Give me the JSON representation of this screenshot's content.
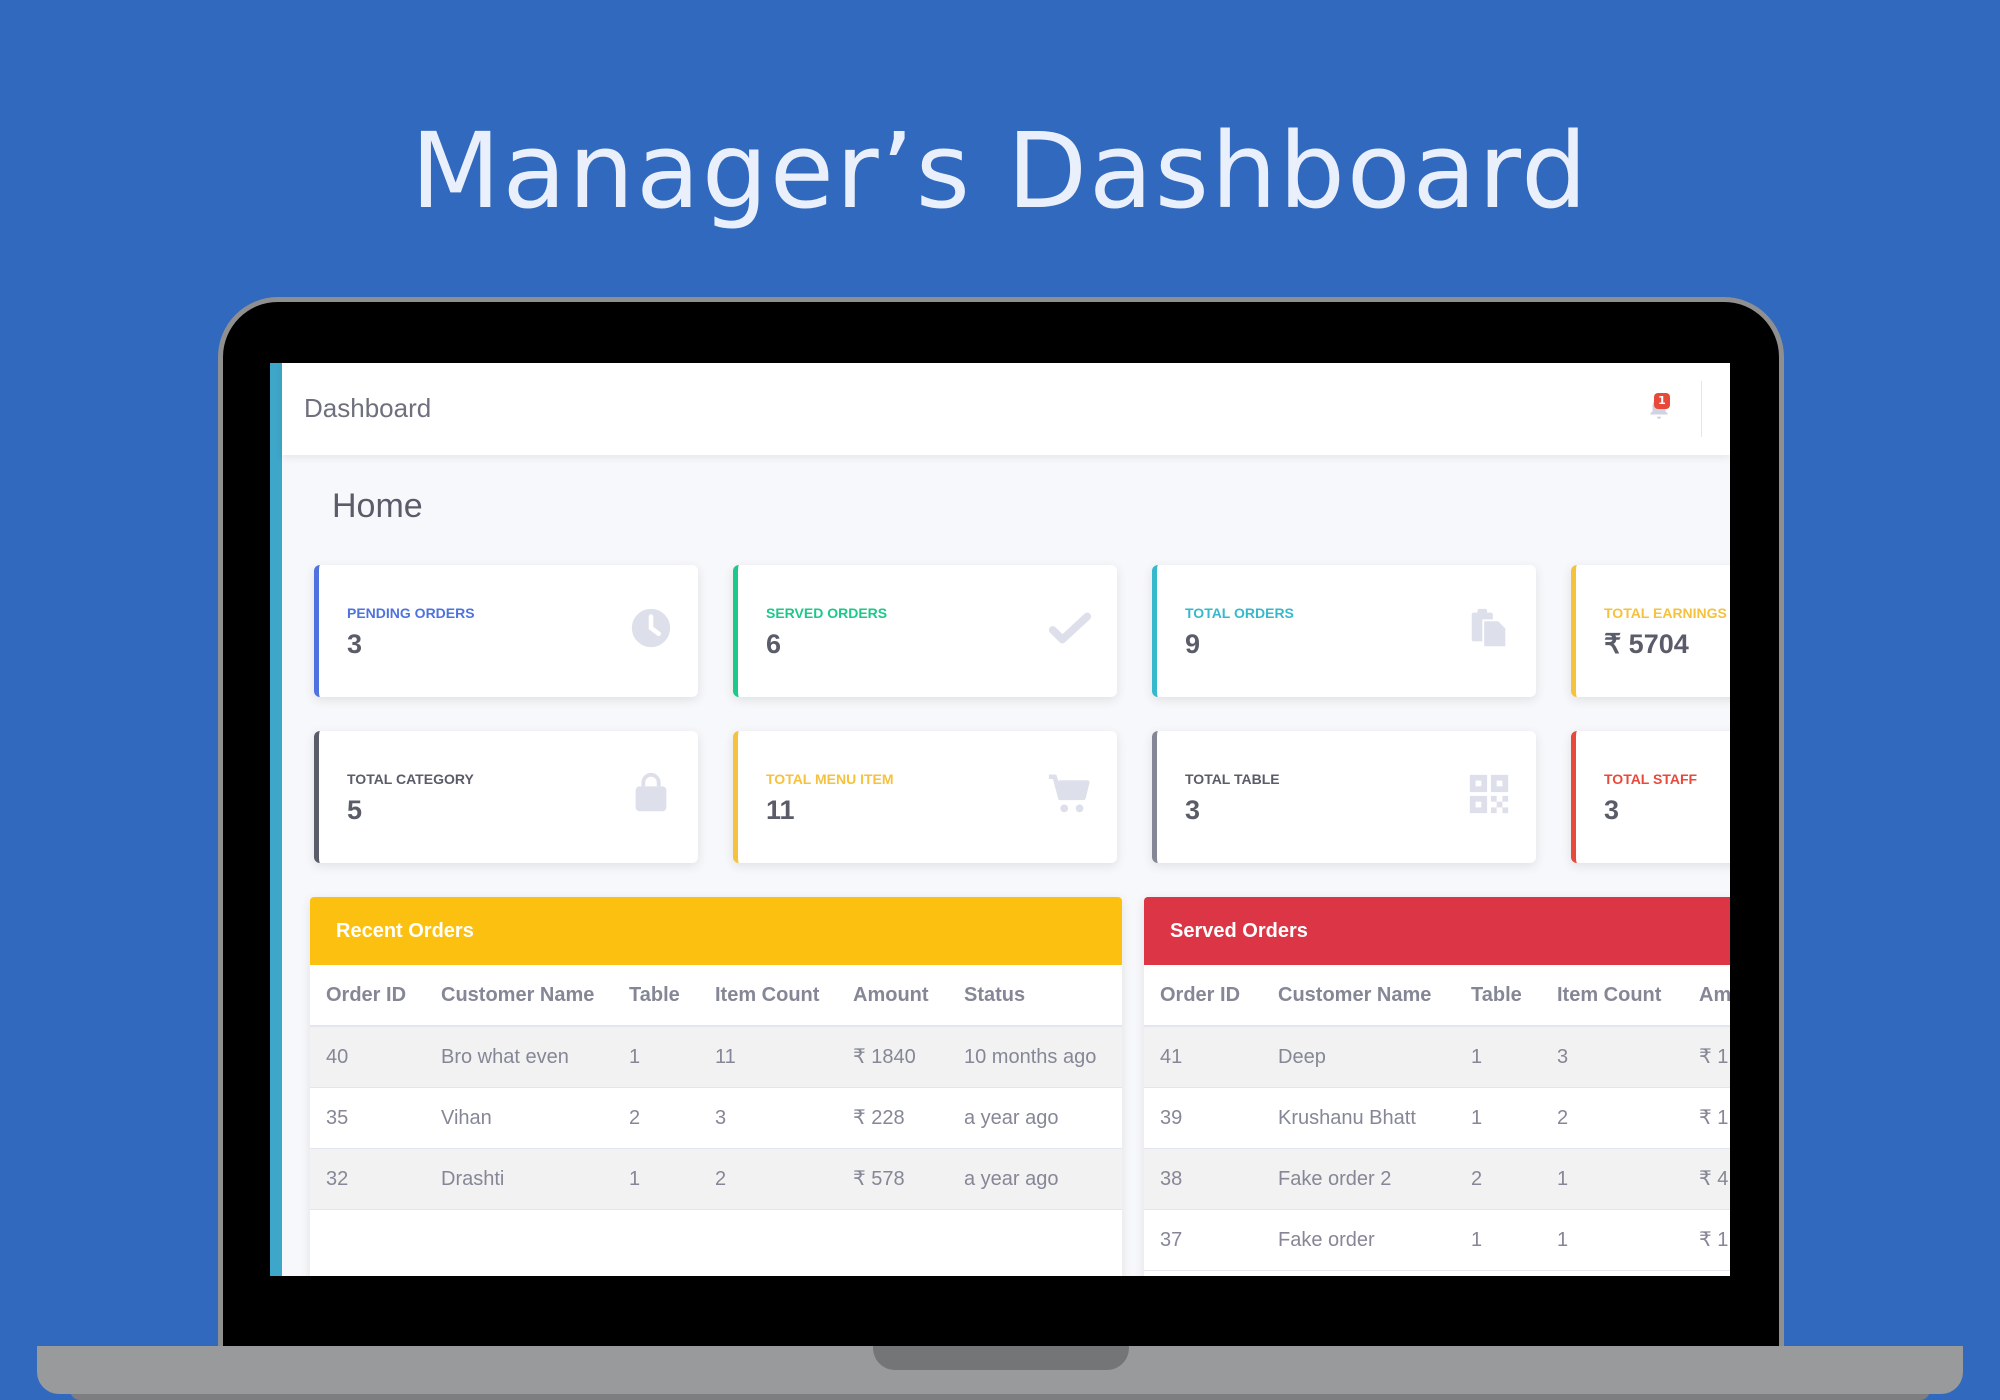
{
  "hero": {
    "title": "Manager’s Dashboard"
  },
  "topbar": {
    "breadcrumb": "Dashboard",
    "notification_count": "1"
  },
  "page": {
    "title": "Home"
  },
  "stats": [
    {
      "label": "PENDING ORDERS",
      "value": "3",
      "color": "#4e73df",
      "icon": "clock-icon"
    },
    {
      "label": "SERVED ORDERS",
      "value": "6",
      "color": "#1cc88a",
      "icon": "check-icon"
    },
    {
      "label": "TOTAL ORDERS",
      "value": "9",
      "color": "#36b9cc",
      "icon": "clipboard-icon"
    },
    {
      "label": "TOTAL EARNINGS",
      "value": "₹ 5704",
      "color": "#f6c23e",
      "icon": ""
    },
    {
      "label": "TOTAL CATEGORY",
      "value": "5",
      "color": "#5a5c69",
      "icon": "shopping-bag-icon"
    },
    {
      "label": "TOTAL MENU ITEM",
      "value": "11",
      "color": "#f6c23e",
      "icon": "cart-icon"
    },
    {
      "label": "TOTAL TABLE",
      "value": "3",
      "color": "#858796",
      "icon": "qrcode-icon"
    },
    {
      "label": "TOTAL STAFF",
      "value": "3",
      "color": "#e74a3b",
      "icon": ""
    }
  ],
  "recent_orders": {
    "title": "Recent Orders",
    "color": "#fbc010",
    "headers": [
      "Order ID",
      "Customer Name",
      "Table",
      "Item Count",
      "Amount",
      "Status"
    ],
    "rows": [
      [
        "40",
        "Bro what even",
        "1",
        "11",
        "₹ 1840",
        "10 months ago"
      ],
      [
        "35",
        "Vihan",
        "2",
        "3",
        "₹ 228",
        "a year ago"
      ],
      [
        "32",
        "Drashti",
        "1",
        "2",
        "₹ 578",
        "a year ago"
      ]
    ]
  },
  "served_orders": {
    "title": "Served Orders",
    "color": "#dc3545",
    "headers": [
      "Order ID",
      "Customer Name",
      "Table",
      "Item Count",
      "Am"
    ],
    "rows": [
      [
        "41",
        "Deep",
        "1",
        "3",
        "₹ 1"
      ],
      [
        "39",
        "Krushanu Bhatt",
        "1",
        "2",
        "₹ 1"
      ],
      [
        "38",
        "Fake order 2",
        "2",
        "1",
        "₹ 4"
      ],
      [
        "37",
        "Fake order",
        "1",
        "1",
        "₹ 1"
      ]
    ]
  }
}
